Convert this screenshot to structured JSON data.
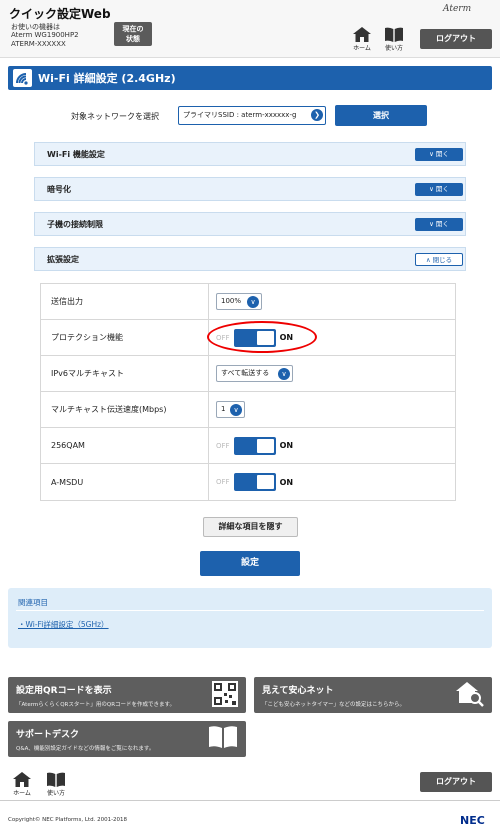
{
  "header": {
    "app_title": "クイック設定Web",
    "model_caption": "お使いの機器は",
    "model_name": "Aterm WG1900HP2",
    "model_serial": "ATERM-XXXXXX",
    "status_button_line1": "現在の",
    "status_button_line2": "状態",
    "brand": "Aterm",
    "home_label": "ホーム",
    "help_label": "使い方",
    "logout_label": "ログアウト"
  },
  "page": {
    "title": "Wi-Fi 詳細設定 (2.4GHz)",
    "network_label": "対象ネットワークを選択",
    "network_value": "プライマリSSID : aterm-xxxxxx-g",
    "select_button": "選択"
  },
  "sections": [
    {
      "label": "Wi-Fi 機能設定",
      "toggle": "開く"
    },
    {
      "label": "暗号化",
      "toggle": "開く"
    },
    {
      "label": "子機の接続制限",
      "toggle": "開く"
    },
    {
      "label": "拡張設定",
      "toggle": "閉じる"
    }
  ],
  "settings": {
    "tx_power": {
      "label": "送信出力",
      "value": "100%"
    },
    "protection": {
      "label": "プロテクション機能",
      "off": "OFF",
      "on": "ON"
    },
    "ipv6_multicast": {
      "label": "IPv6マルチキャスト",
      "value": "すべて転送する"
    },
    "multicast_rate": {
      "label": "マルチキャスト伝送速度(Mbps)",
      "value": "1"
    },
    "qam256": {
      "label": "256QAM",
      "off": "OFF",
      "on": "ON"
    },
    "amsdu": {
      "label": "A-MSDU",
      "off": "OFF",
      "on": "ON"
    }
  },
  "actions": {
    "hide_details": "詳細な項目を隠す",
    "submit": "設定"
  },
  "related": {
    "title": "関連項目",
    "link": "Wi-Fi詳細設定（5GHz）"
  },
  "tiles": {
    "qr": {
      "title": "設定用QRコードを表示",
      "desc": "「AtermらくらくQRスタート」用のQRコードを作成できます。"
    },
    "timer": {
      "title": "見えて安心ネット",
      "desc": "「こども安心ネットタイマー」などの設定はこちらから。"
    },
    "support": {
      "title": "サポートデスク",
      "desc": "Q&A、機能別設定ガイドなどの情報をご覧になれます。"
    }
  },
  "footer": {
    "home_label": "ホーム",
    "help_label": "使い方",
    "logout_label": "ログアウト",
    "copyright": "Copyright© NEC Platforms, Ltd. 2001-2018",
    "logo": "NEC"
  },
  "colors": {
    "accent": "#1d61ad",
    "highlight": "#e00000",
    "tile": "#5e5e5e"
  }
}
